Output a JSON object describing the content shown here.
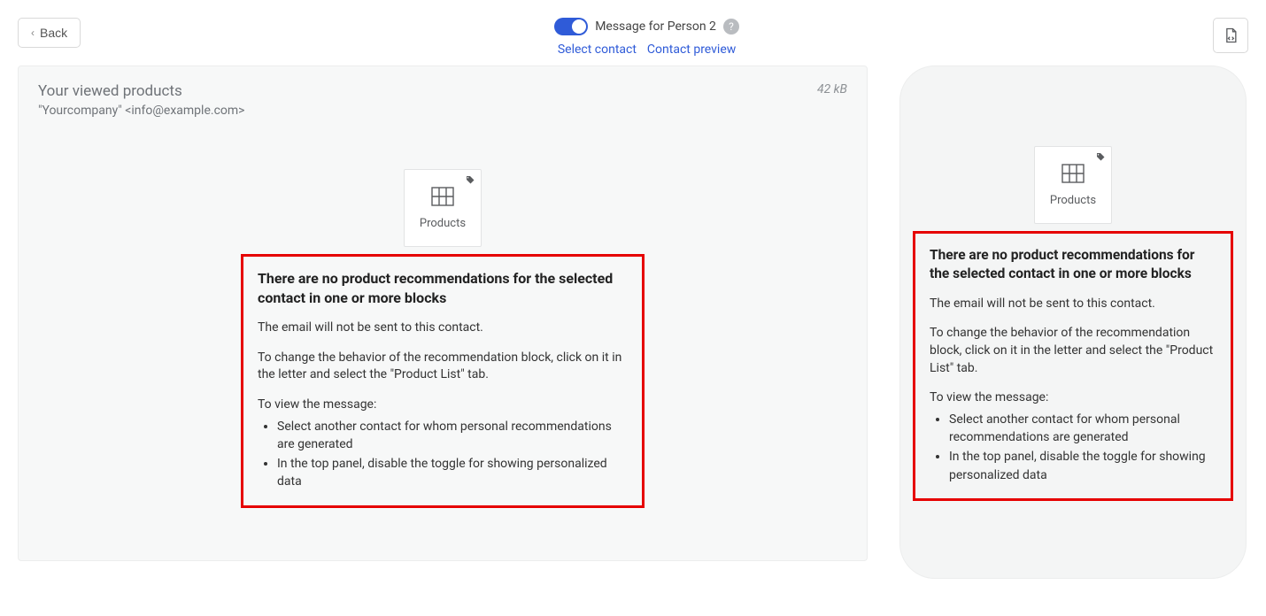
{
  "topbar": {
    "back_label": "Back",
    "toggle_label": "Message for Person 2",
    "links": {
      "select_contact": "Select contact",
      "contact_preview": "Contact preview"
    }
  },
  "preview": {
    "subject": "Your viewed products",
    "from": "\"Yourcompany\" <info@example.com>",
    "size": "42 kB",
    "products_block_label": "Products"
  },
  "warning": {
    "title": "There are no product recommendations for the selected contact in one or more blocks",
    "p1": "The email will not be sent to this contact.",
    "p2": "To change the behavior of the recommendation block, click on it in the letter and select the \"Product List\" tab.",
    "p3": "To view the message:",
    "li1": "Select another contact for whom personal recommendations are generated",
    "li2": "In the top panel, disable the toggle for showing personalized data"
  }
}
